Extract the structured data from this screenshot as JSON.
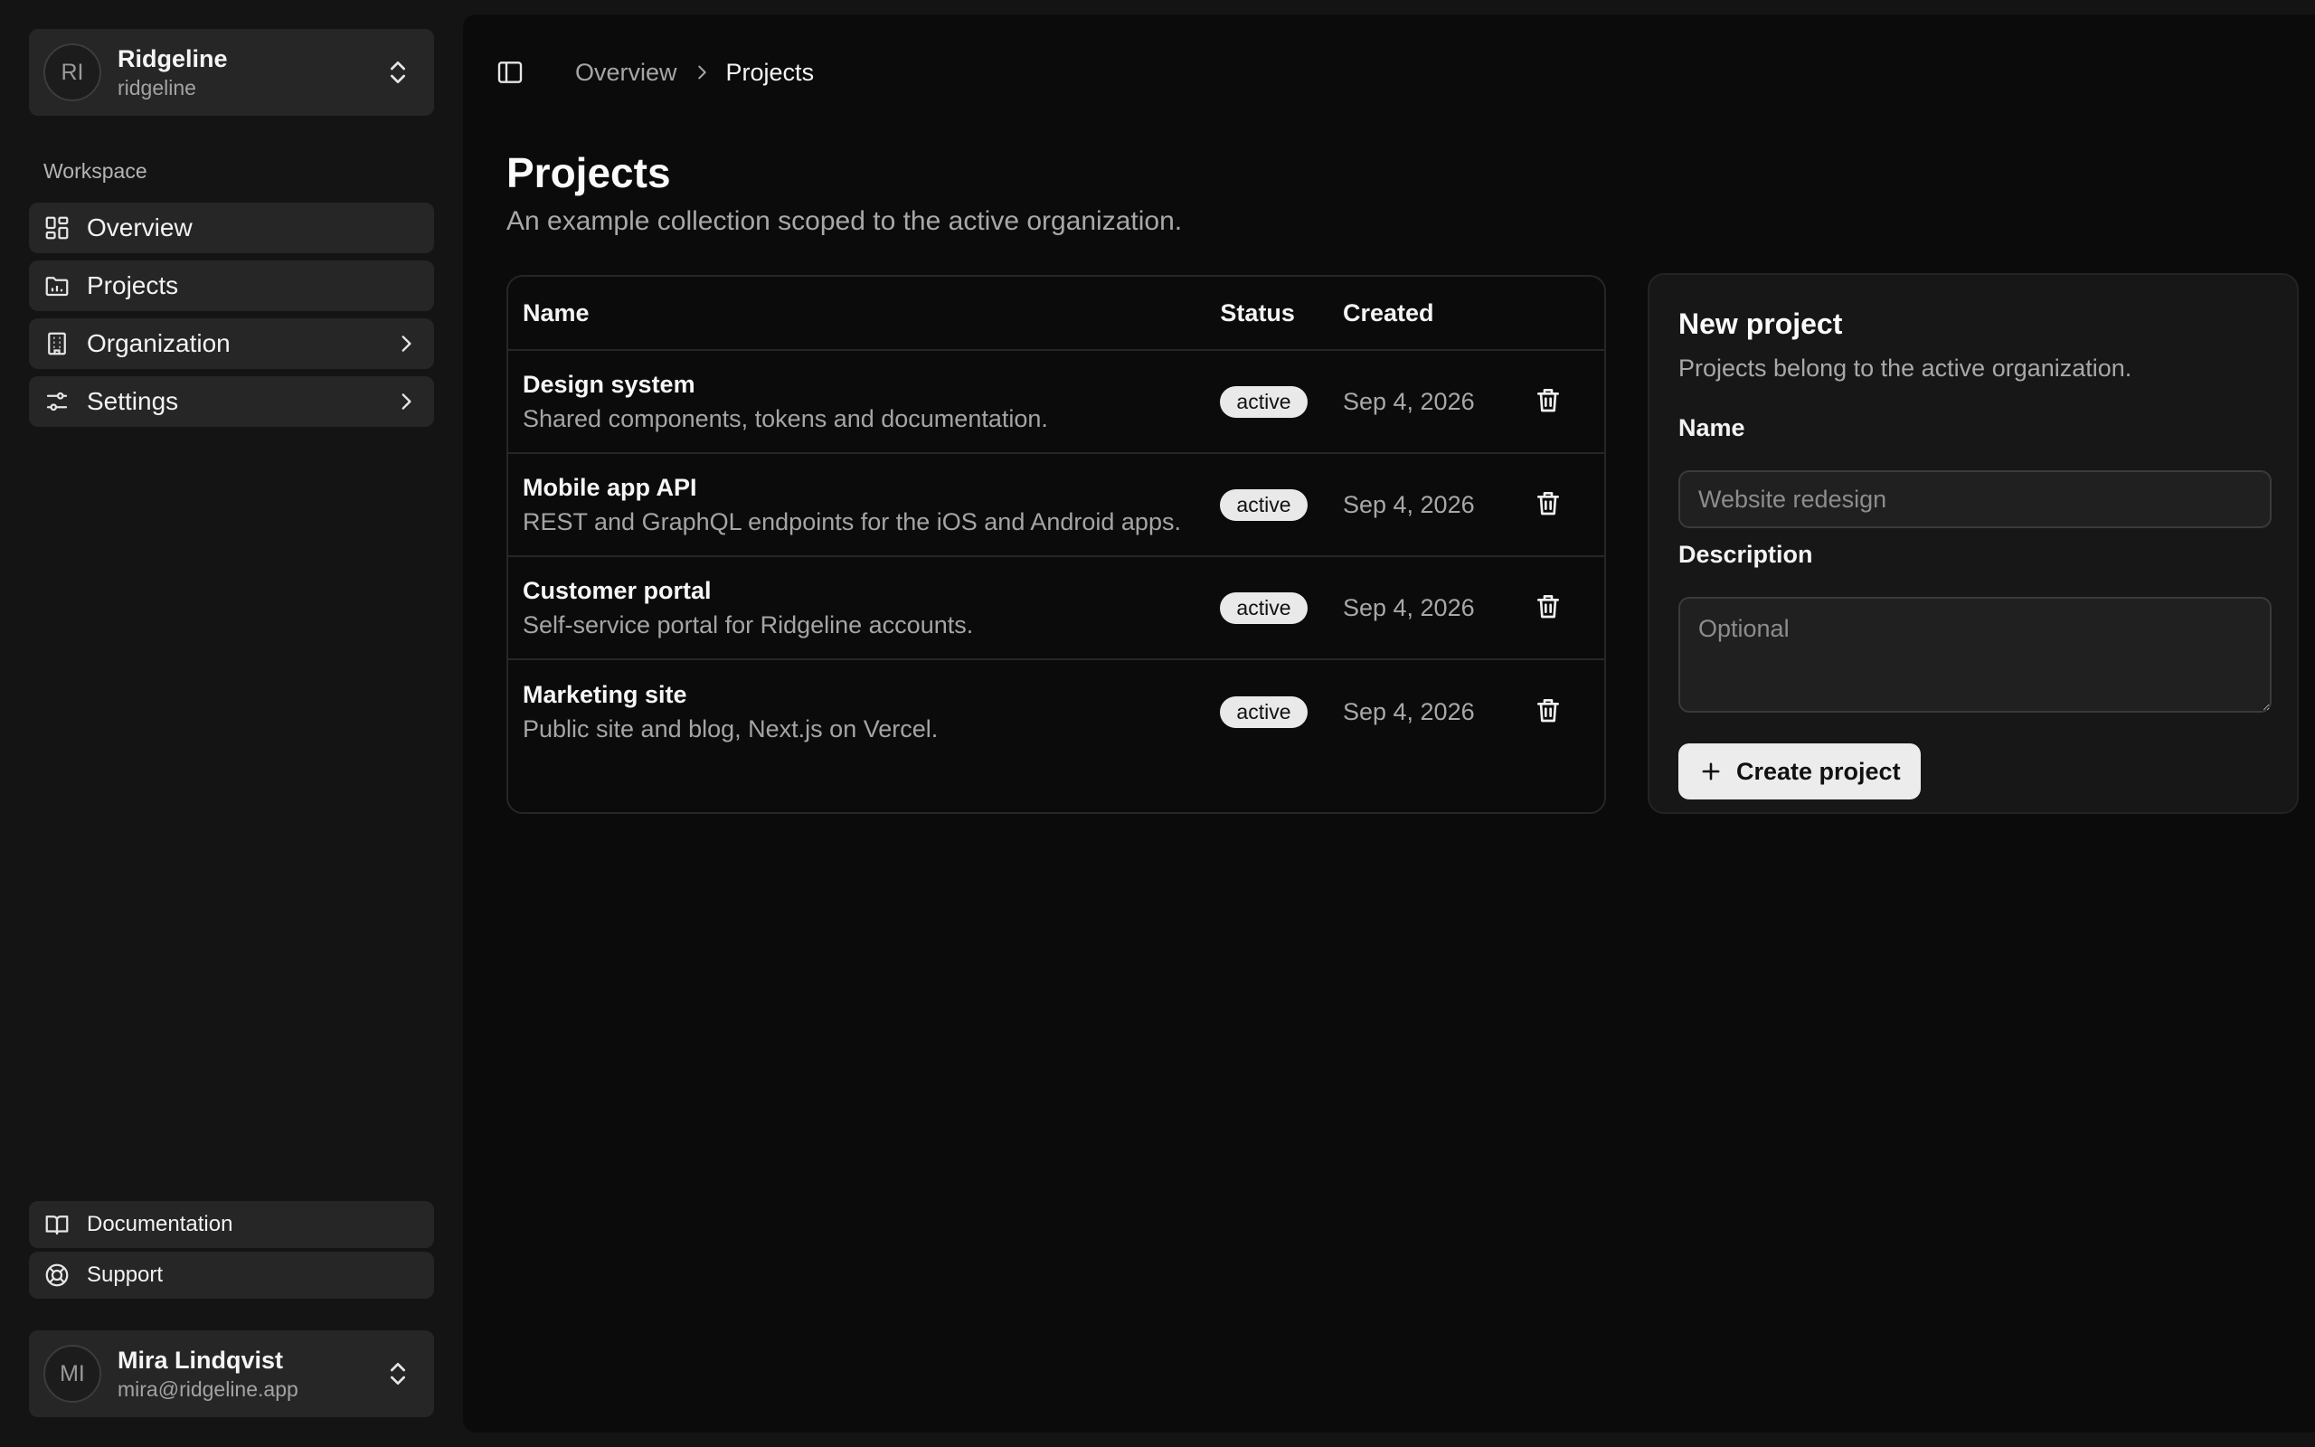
{
  "org": {
    "initials": "RI",
    "name": "Ridgeline",
    "slug": "ridgeline"
  },
  "sidebar": {
    "section_label": "Workspace",
    "items": [
      {
        "label": "Overview",
        "icon": "dashboard-icon"
      },
      {
        "label": "Projects",
        "icon": "folder-chart-icon"
      },
      {
        "label": "Organization",
        "icon": "building-icon"
      },
      {
        "label": "Settings",
        "icon": "sliders-icon"
      }
    ],
    "footer": [
      {
        "label": "Documentation",
        "icon": "book-open-icon"
      },
      {
        "label": "Support",
        "icon": "life-buoy-icon"
      }
    ]
  },
  "user": {
    "initials": "MI",
    "name": "Mira Lindqvist",
    "email": "mira@ridgeline.app"
  },
  "breadcrumb": {
    "parent": "Overview",
    "current": "Projects"
  },
  "page": {
    "title": "Projects",
    "subtitle": "An example collection scoped to the active organization."
  },
  "table": {
    "headers": {
      "name": "Name",
      "status": "Status",
      "created": "Created"
    },
    "rows": [
      {
        "name": "Design system",
        "description": "Shared components, tokens and documentation.",
        "status": "active",
        "created": "Sep 4, 2026"
      },
      {
        "name": "Mobile app API",
        "description": "REST and GraphQL endpoints for the iOS and Android apps.",
        "status": "active",
        "created": "Sep 4, 2026"
      },
      {
        "name": "Customer portal",
        "description": "Self-service portal for Ridgeline accounts.",
        "status": "active",
        "created": "Sep 4, 2026"
      },
      {
        "name": "Marketing site",
        "description": "Public site and blog, Next.js on Vercel.",
        "status": "active",
        "created": "Sep 4, 2026"
      }
    ]
  },
  "form": {
    "title": "New project",
    "subtitle": "Projects belong to the active organization.",
    "name_label": "Name",
    "name_placeholder": "Website redesign",
    "description_label": "Description",
    "description_placeholder": "Optional",
    "submit_label": "Create project"
  },
  "colors": {
    "sidebar_bg": "#141414",
    "main_bg": "#0b0b0b",
    "card_bg": "#171717",
    "item_bg": "#262626",
    "badge_bg": "#e9e9e9",
    "button_bg": "#ececec"
  }
}
